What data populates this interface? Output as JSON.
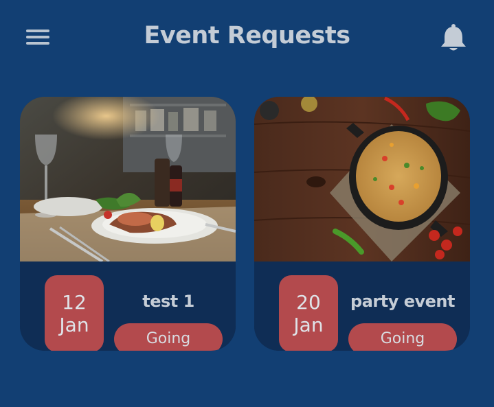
{
  "header": {
    "title": "Event Requests",
    "menu_icon": "hamburger-menu-icon",
    "notification_icon": "bell-icon"
  },
  "events": [
    {
      "image": "restaurant-table-photo",
      "day": "12",
      "month": "Jan",
      "name": "test 1",
      "status_label": "Going"
    },
    {
      "image": "paella-pan-photo",
      "day": "20",
      "month": "Jan",
      "name": "party event",
      "status_label": "Going"
    }
  ],
  "colors": {
    "background": "#123f73",
    "card": "#0f2d55",
    "accent": "#b34a4d",
    "text": "#c4ccd6"
  }
}
